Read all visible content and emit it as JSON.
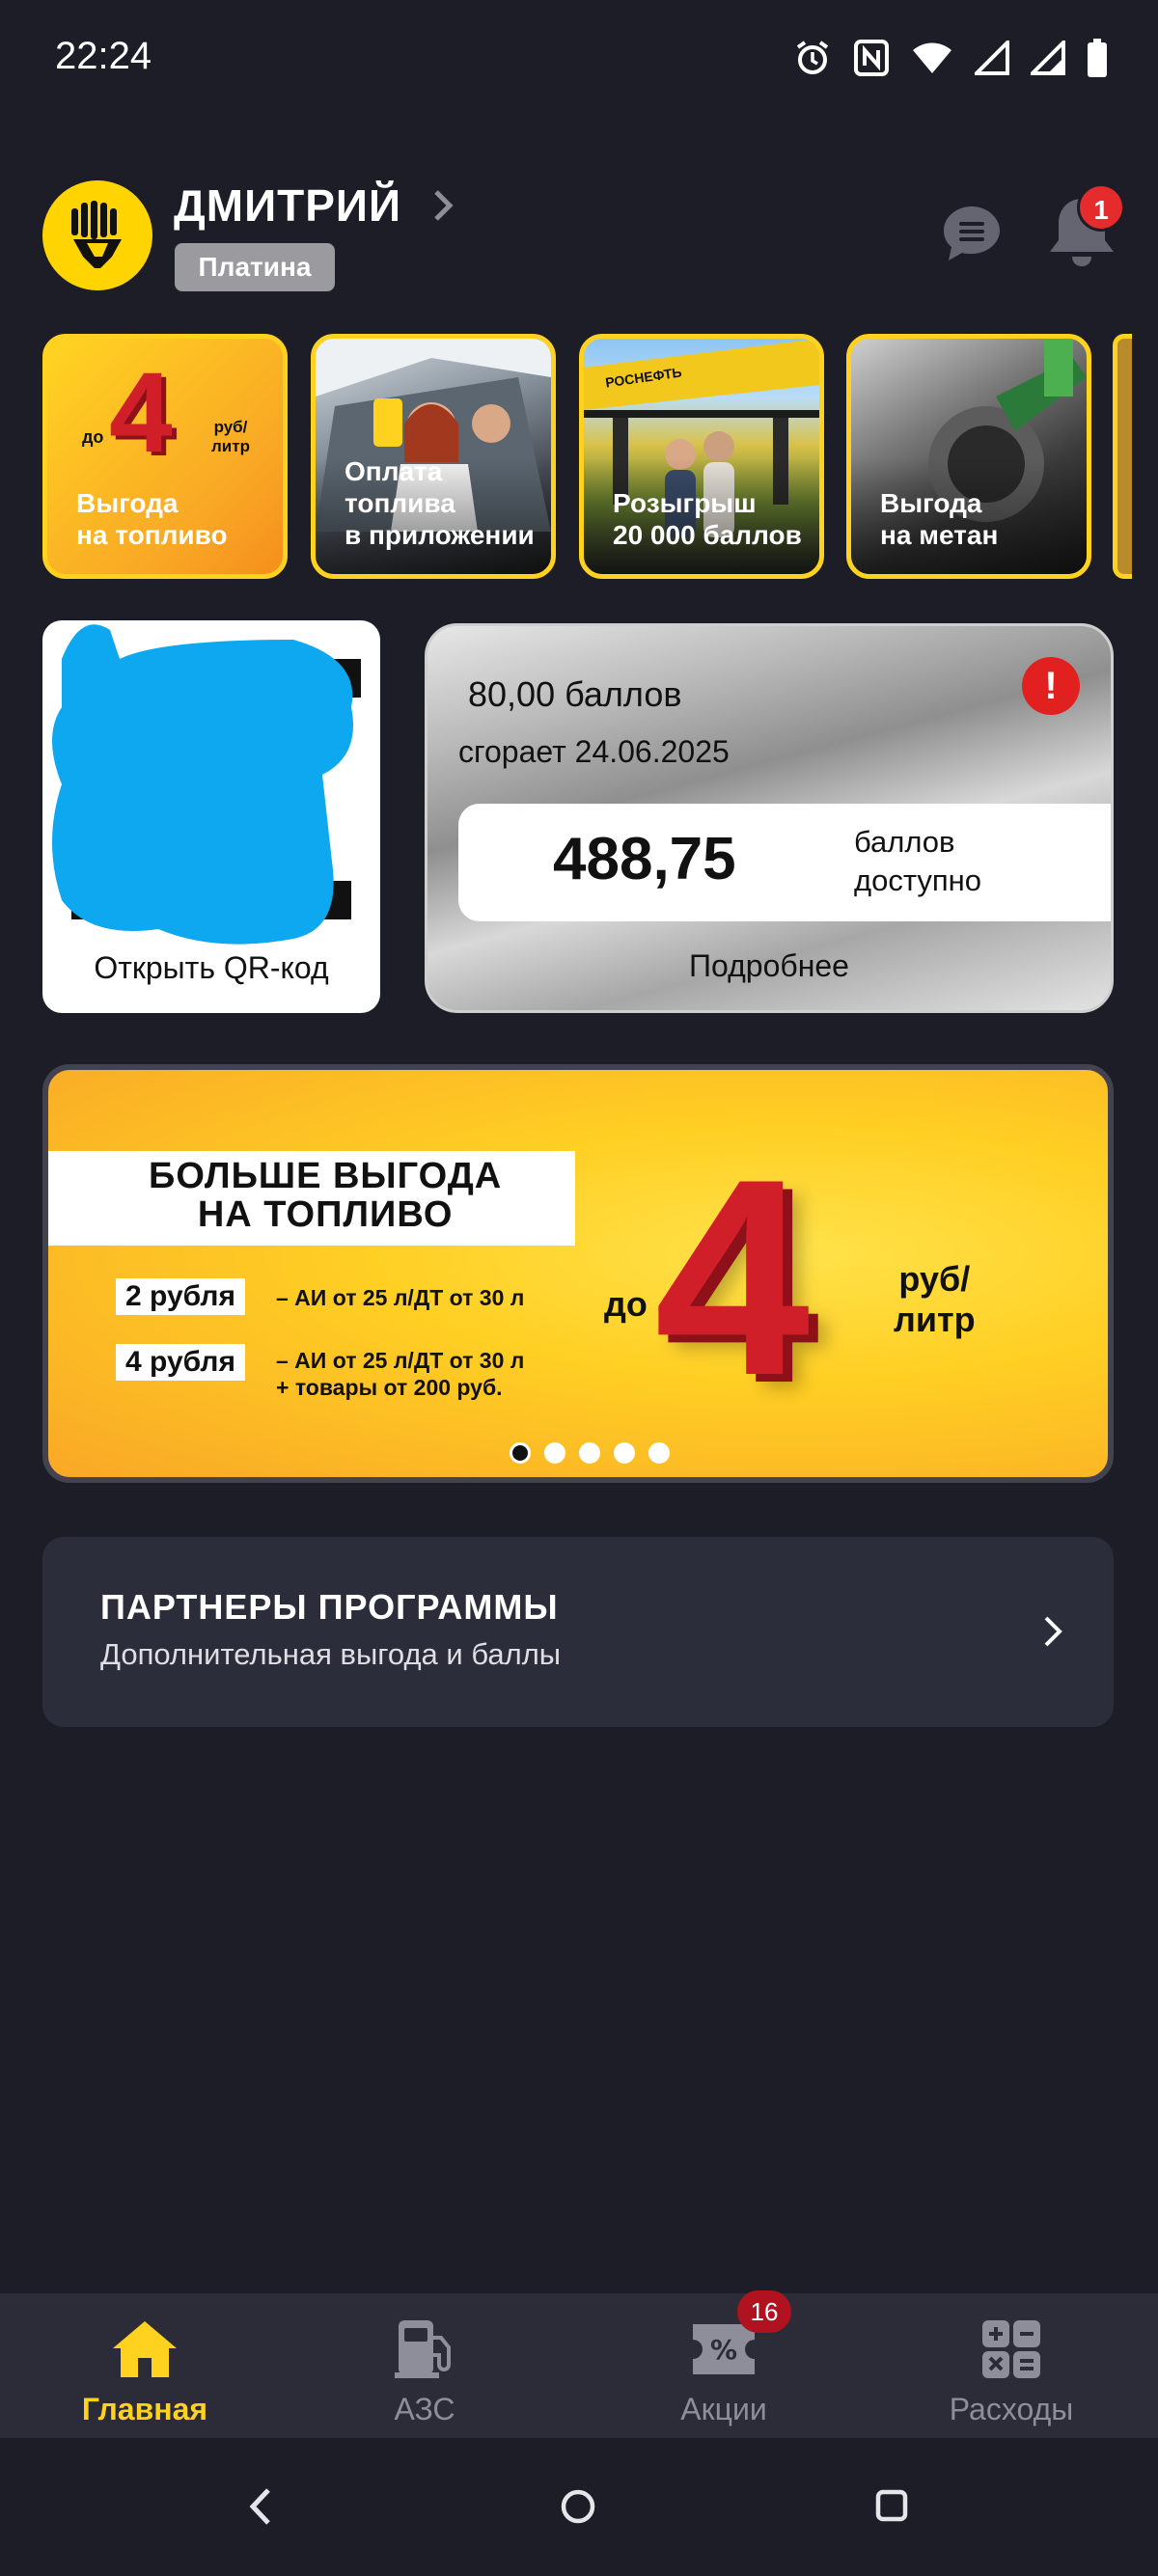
{
  "status_bar": {
    "time": "22:24",
    "icons": [
      "alarm-icon",
      "nfc-icon",
      "wifi-icon",
      "signal-icon",
      "signal-icon",
      "battery-icon"
    ]
  },
  "header": {
    "user_name": "ДМИТРИЙ",
    "tier": "Платина",
    "notification_count": "1",
    "brand_color": "#ffd400"
  },
  "stories": [
    {
      "label": "Выгода\nна топливо",
      "badge_prefix": "до",
      "badge_number": "4",
      "badge_unit": "руб/\nлитр"
    },
    {
      "label": "Оплата\nтоплива\nв приложении"
    },
    {
      "label": "Розыгрыш\n20 000 баллов",
      "sign_text": "РОСНЕФТЬ"
    },
    {
      "label": "Выгода\nна метан"
    }
  ],
  "qr_card": {
    "label": "Открыть QR-код"
  },
  "balance_card": {
    "expiring_points": "80,00 баллов",
    "expiring_date": "сгорает 24.06.2025",
    "available_points": "488,75",
    "available_label": "баллов\nдоступно",
    "details_link": "Подробнее",
    "alert_symbol": "!"
  },
  "promo_banner": {
    "title": "БОЛЬШЕ ВЫГОДА\nНА ТОПЛИВО",
    "tier1_chip": "2 рубля",
    "tier1_condition": "–  АИ от 25 л/ДТ от 30 л",
    "tier2_chip": "4 рубля",
    "tier2_condition": "–  АИ от 25 л/ДТ от 30 л\n    + товары от 200 руб.",
    "prefix": "до",
    "big_number": "4",
    "unit": "руб/\nлитр",
    "slides_total": 5,
    "active_slide": 1
  },
  "partners": {
    "title": "ПАРТНЕРЫ ПРОГРАММЫ",
    "subtitle": "Дополнительная выгода и баллы"
  },
  "bottom_nav": {
    "items": [
      {
        "label": "Главная",
        "icon": "home-icon",
        "active": true
      },
      {
        "label": "АЗС",
        "icon": "fuel-pump-icon",
        "active": false
      },
      {
        "label": "Акции",
        "icon": "discount-ticket-icon",
        "active": false,
        "badge": "16"
      },
      {
        "label": "Расходы",
        "icon": "calculator-icon",
        "active": false
      }
    ],
    "active_color": "#ffd21f",
    "inactive_color": "#8d8e9a"
  },
  "system_nav": {
    "icons": [
      "back-icon",
      "home-circle-icon",
      "recents-icon"
    ]
  }
}
